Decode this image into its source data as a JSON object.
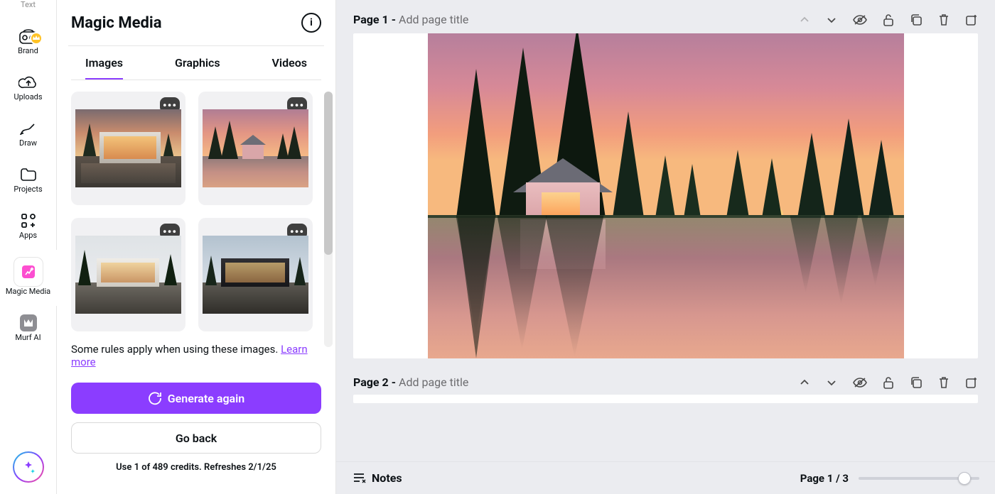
{
  "rail": {
    "items": [
      {
        "label": "Text"
      },
      {
        "label": "Brand"
      },
      {
        "label": "Uploads"
      },
      {
        "label": "Draw"
      },
      {
        "label": "Projects"
      },
      {
        "label": "Apps"
      },
      {
        "label": "Magic Media"
      },
      {
        "label": "Murf AI"
      }
    ]
  },
  "panel": {
    "title": "Magic Media",
    "tabs": [
      "Images",
      "Graphics",
      "Videos"
    ],
    "active_tab": 0,
    "rules_prefix": "Some rules apply when using these images. ",
    "rules_link": "Learn more",
    "generate_label": "Generate again",
    "back_label": "Go back",
    "credits": "Use 1 of 489 credits. Refreshes 2/1/25"
  },
  "canvas": {
    "pages": [
      {
        "label": "Page 1",
        "sep": " - ",
        "placeholder": "Add page title"
      },
      {
        "label": "Page 2",
        "sep": " - ",
        "placeholder": "Add page title"
      }
    ]
  },
  "footer": {
    "notes": "Notes",
    "page_indicator": "Page 1 / 3"
  },
  "colors": {
    "accent": "#8b3dff"
  }
}
